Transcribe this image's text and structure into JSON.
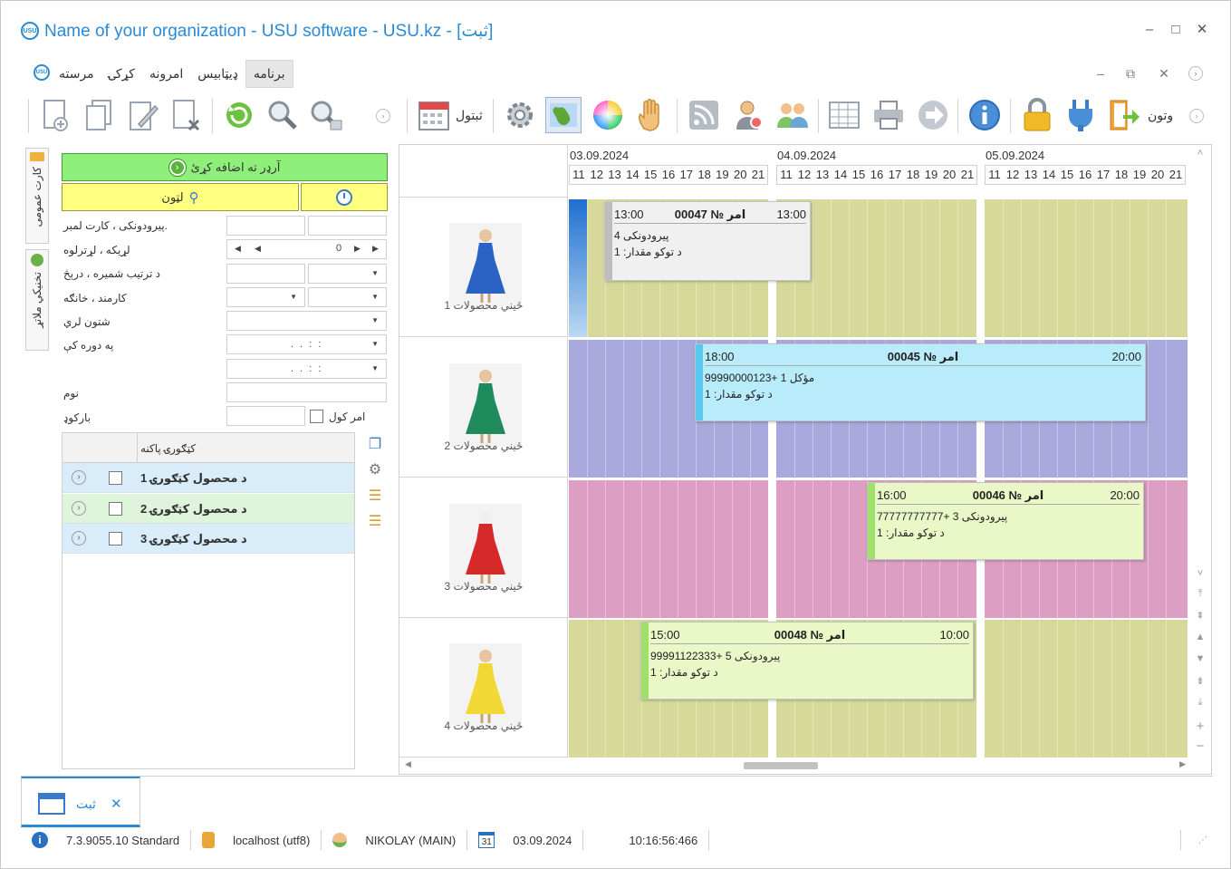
{
  "window": {
    "title": "Name of your organization - USU software - USU.kz - [ثبت]",
    "logo_text": "USU",
    "controls": [
      "–",
      "□",
      "✕"
    ]
  },
  "menu": {
    "items": [
      "برنامه",
      "ډیټابیس",
      "امرونه",
      "کړکۍ",
      "مرسته"
    ],
    "active": "برنامه",
    "mdi_controls": [
      "–",
      "⧉",
      "✕"
    ]
  },
  "toolbar": {
    "schedule_label": "ثبتول",
    "exit_label": "وتون",
    "icons": [
      "add-document-icon",
      "copy-document-icon",
      "edit-document-icon",
      "delete-document-icon",
      "refresh-icon",
      "search-icon",
      "advanced-search-icon",
      "calendar-icon",
      "settings-icon",
      "map-icon",
      "color-wheel-icon",
      "hand-icon",
      "rss-icon",
      "user-manager-icon",
      "users-group-icon",
      "table-icon",
      "print-icon",
      "forward-icon",
      "info-icon",
      "lock-icon",
      "plugin-icon",
      "exit-icon"
    ]
  },
  "side_tabs": [
    "کارت عمومی",
    "تخنیکي ملاتړ"
  ],
  "filters": {
    "add_order": "آرډر ته اضافه کړئ",
    "search": "لټون",
    "rows": [
      {
        "label": "پیرودونکی ، کارت لمبر."
      },
      {
        "label": "لړیکه ، لړترلوه",
        "value": "0"
      },
      {
        "label": "د ترتیب شمیره ، درېڅ"
      },
      {
        "label": "کارمند ، خانګه"
      },
      {
        "label": "شتون لري"
      },
      {
        "label": "په دوره کې",
        "mask": ". .   : :"
      },
      {
        "label": "",
        "mask": ". .   : :"
      },
      {
        "label": "نوم"
      },
      {
        "label": "بارکوډ",
        "checkbox_label": "امر کول"
      }
    ],
    "category_header": "کټګورۍ پاکنه",
    "categories": [
      "د محصول کټګورۍ 1",
      "د محصول کټګورۍ 2",
      "د محصول کټګورۍ 3"
    ]
  },
  "schedule": {
    "days": [
      "03.09.2024",
      "04.09.2024",
      "05.09.2024"
    ],
    "hours": [
      "11",
      "12",
      "13",
      "14",
      "15",
      "16",
      "17",
      "18",
      "19",
      "20",
      "21"
    ],
    "products": [
      "ځیني محصولات 1",
      "ځیني محصولات 2",
      "ځیني محصولات 3",
      "ځیني محصولات 4"
    ],
    "row_colors": [
      "#d7d99a",
      "#a9a9de",
      "#dc9ec2",
      "#d7d99a"
    ],
    "events": [
      {
        "start": "13:00",
        "title": "امر № 00047",
        "end": "13:00",
        "line1": "پیرودونکی 4",
        "line2": "د توکو مقدار: 1",
        "bg": "#f0f0f0",
        "strip": "#bdbdbd"
      },
      {
        "start": "18:00",
        "title": "امر № 00045",
        "end": "20:00",
        "line1": "مؤکل 1 +99990000123",
        "line2": "د توکو مقدار: 1",
        "bg": "#b8ecfa",
        "strip": "#5bc8ee"
      },
      {
        "start": "16:00",
        "title": "امر № 00046",
        "end": "20:00",
        "line1": "پیرودونکی 3 +77777777777",
        "line2": "د توکو مقدار: 1",
        "bg": "#eaf8c8",
        "strip": "#9ee06a"
      },
      {
        "start": "15:00",
        "title": "امر № 00048",
        "end": "10:00",
        "line1": "پیرودونکی 5 +99991122333",
        "line2": "د توکو مقدار: 1",
        "bg": "#eaf8c8",
        "strip": "#9ee06a"
      }
    ]
  },
  "bottom_tab": {
    "label": "ثبت",
    "close": "✕"
  },
  "status": {
    "version": "7.3.9055.10 Standard",
    "db": "localhost (utf8)",
    "user": "NIKOLAY (MAIN)",
    "calendar_day": "31",
    "date": "03.09.2024",
    "time": "10:16:56:466"
  }
}
